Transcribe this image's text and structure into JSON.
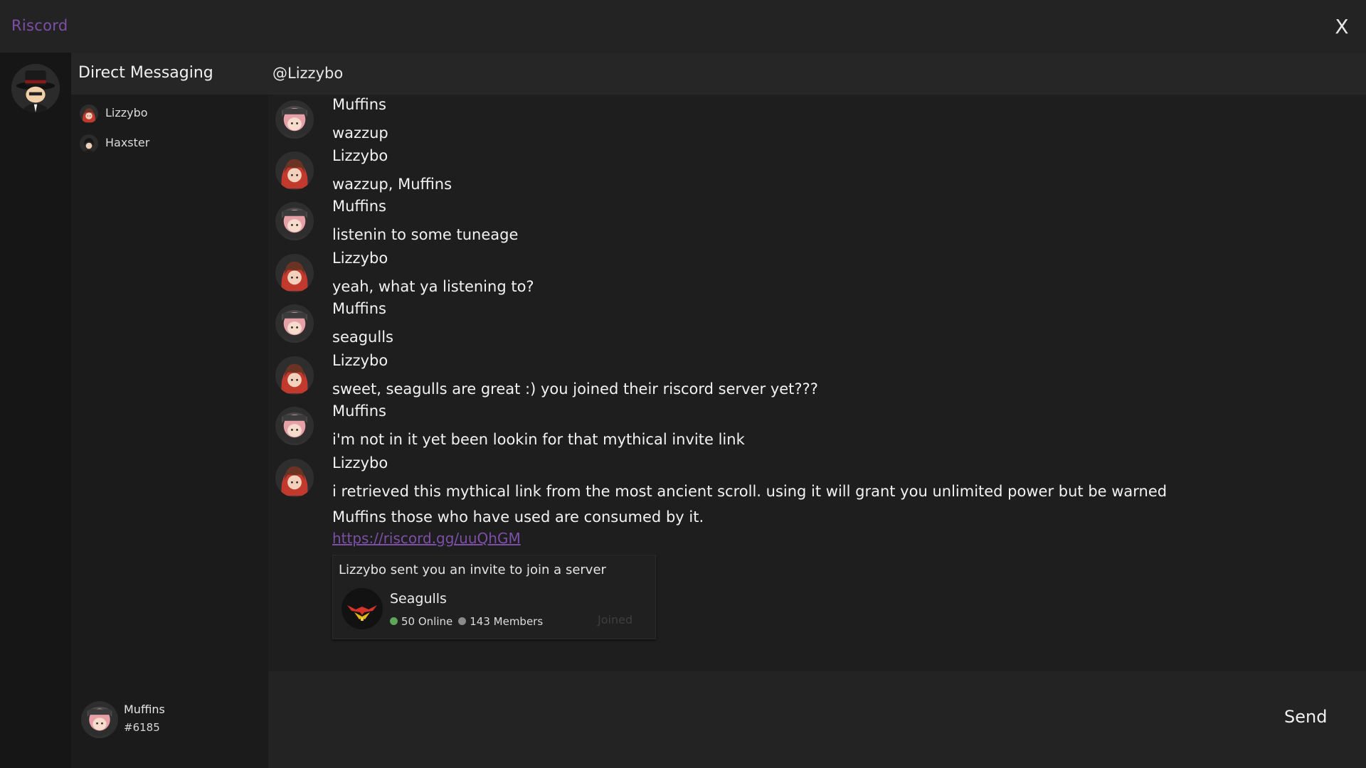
{
  "app": {
    "title": "Riscord",
    "close_label": "X"
  },
  "sidebar": {
    "title": "Direct Messaging",
    "items": [
      {
        "label": "Lizzybo",
        "avatar": "lizzybo-avatar"
      },
      {
        "label": "Haxster",
        "avatar": "haxster-avatar"
      }
    ]
  },
  "chat": {
    "header": "@Lizzybo",
    "messages": [
      {
        "author": "Muffins",
        "text": "wazzup",
        "avatar": "muffins-avatar"
      },
      {
        "author": "Lizzybo",
        "text": "wazzup, Muffins",
        "avatar": "lizzybo-avatar"
      },
      {
        "author": "Muffins",
        "text": "listenin to some tuneage",
        "avatar": "muffins-avatar"
      },
      {
        "author": "Lizzybo",
        "text": "yeah, what ya listening to?",
        "avatar": "lizzybo-avatar"
      },
      {
        "author": "Muffins",
        "text": "seagulls",
        "avatar": "muffins-avatar"
      },
      {
        "author": "Lizzybo",
        "text": "sweet, seagulls are great :) you joined their riscord server yet???",
        "avatar": "lizzybo-avatar"
      },
      {
        "author": "Muffins",
        "text": "i'm not in it yet been lookin for that mythical invite link",
        "avatar": "muffins-avatar"
      },
      {
        "author": "Lizzybo",
        "text": "i retrieved this mythical link from the most ancient scroll. using it will grant you unlimited power but be warned Muffins those who have used are consumed by it.",
        "link": "https://riscord.gg/uuQhGM",
        "avatar": "lizzybo-avatar"
      }
    ],
    "invite": {
      "heading": "Lizzybo sent you an invite to join a server",
      "server_name": "Seagulls",
      "online": "50 Online",
      "members": "143 Members",
      "button_label": "Joined"
    }
  },
  "user": {
    "name": "Muffins",
    "tag": "#6185"
  },
  "composer": {
    "placeholder": "",
    "send_label": "Send"
  },
  "colors": {
    "accent": "#7d4fa8",
    "online": "#5da65a",
    "members": "#8a8a8a"
  }
}
